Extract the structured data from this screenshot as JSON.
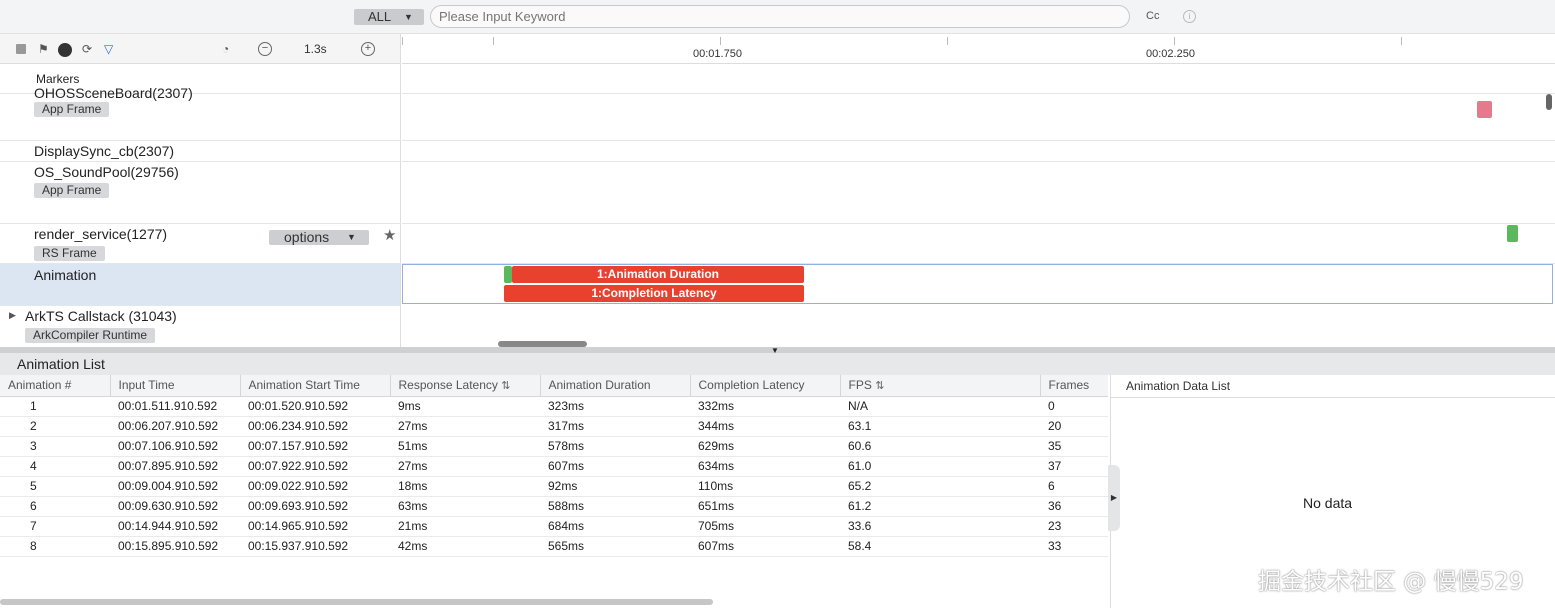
{
  "search": {
    "scope": "ALL",
    "placeholder": "Please Input Keyword",
    "case_label": "Cc"
  },
  "toolbar": {
    "scale": "1.3s",
    "minus": "−",
    "plus": "+"
  },
  "ruler": {
    "labels": [
      "00:01.750",
      "00:02.250"
    ]
  },
  "tracks": {
    "markers": "Markers",
    "row1": {
      "label": "OHOSSceneBoard(2307)",
      "tag": "App Frame"
    },
    "row2": {
      "label": "DisplaySync_cb(2307)"
    },
    "row3": {
      "label": "OS_SoundPool(29756)",
      "tag": "App Frame"
    },
    "row4": {
      "label": "render_service(1277)",
      "tag": "RS Frame",
      "options": "options"
    },
    "row5": {
      "label": "Animation"
    },
    "row6": {
      "label": "ArkTS Callstack (31043)",
      "tag": "ArkCompiler Runtime"
    }
  },
  "slices": {
    "duration": "1:Animation Duration",
    "latency": "1:Completion Latency"
  },
  "colors": {
    "slice_red": "#e8422f",
    "green": "#5cb85c",
    "pink": "#e57a8c",
    "selected_row": "#dce5f2"
  },
  "panel": {
    "title": "Animation List",
    "headers": [
      "Animation #",
      "Input Time",
      "Animation Start Time",
      "Response Latency",
      "Animation Duration",
      "Completion Latency",
      "FPS",
      "Frames"
    ],
    "rows": [
      [
        "1",
        "00:01.511.910.592",
        "00:01.520.910.592",
        "9ms",
        "323ms",
        "332ms",
        "N/A",
        "0"
      ],
      [
        "2",
        "00:06.207.910.592",
        "00:06.234.910.592",
        "27ms",
        "317ms",
        "344ms",
        "63.1",
        "20"
      ],
      [
        "3",
        "00:07.106.910.592",
        "00:07.157.910.592",
        "51ms",
        "578ms",
        "629ms",
        "60.6",
        "35"
      ],
      [
        "4",
        "00:07.895.910.592",
        "00:07.922.910.592",
        "27ms",
        "607ms",
        "634ms",
        "61.0",
        "37"
      ],
      [
        "5",
        "00:09.004.910.592",
        "00:09.022.910.592",
        "18ms",
        "92ms",
        "110ms",
        "65.2",
        "6"
      ],
      [
        "6",
        "00:09.630.910.592",
        "00:09.693.910.592",
        "63ms",
        "588ms",
        "651ms",
        "61.2",
        "36"
      ],
      [
        "7",
        "00:14.944.910.592",
        "00:14.965.910.592",
        "21ms",
        "684ms",
        "705ms",
        "33.6",
        "23"
      ],
      [
        "8",
        "00:15.895.910.592",
        "00:15.937.910.592",
        "42ms",
        "565ms",
        "607ms",
        "58.4",
        "33"
      ]
    ]
  },
  "detail": {
    "title": "Animation Data List",
    "empty": "No data"
  },
  "watermark": "掘金技术社区 @ 慢慢529"
}
